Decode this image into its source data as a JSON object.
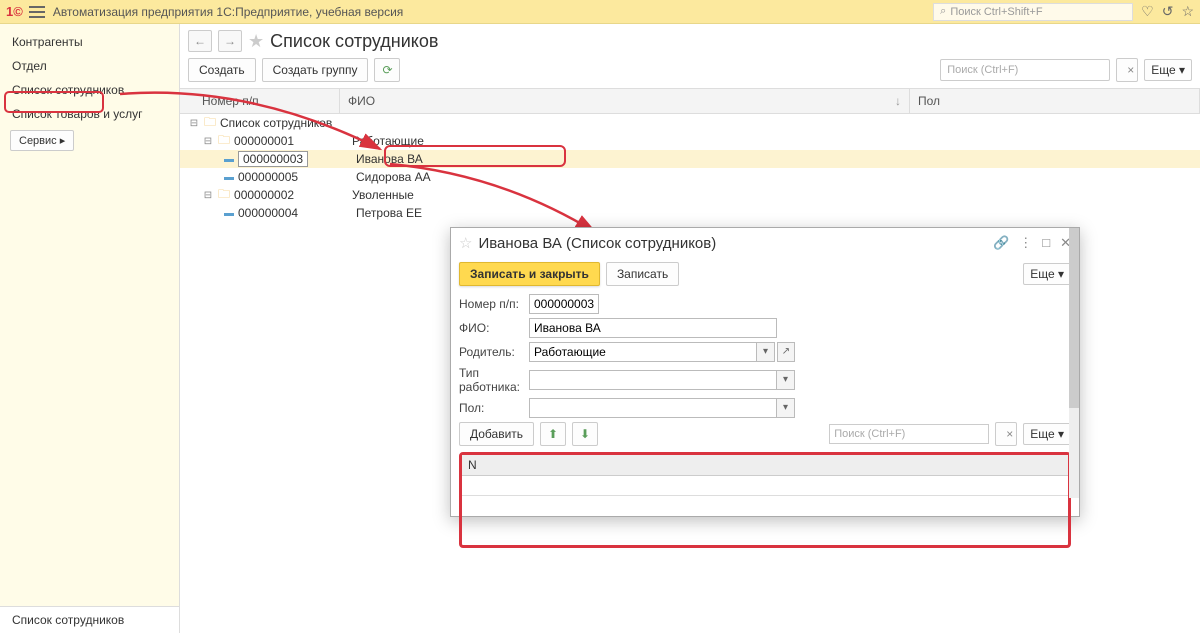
{
  "topbar": {
    "logo": "1©",
    "title": "Автоматизация предприятия 1С:Предприятие, учебная версия",
    "search_placeholder": "Поиск Ctrl+Shift+F"
  },
  "sidebar": {
    "items": [
      {
        "label": "Контрагенты"
      },
      {
        "label": "Отдел"
      },
      {
        "label": "Список сотрудников"
      },
      {
        "label": "Список товаров и услуг"
      }
    ],
    "service": "Сервис ▸",
    "bottom": "Список сотрудников"
  },
  "page": {
    "title": "Список сотрудников",
    "create": "Создать",
    "create_group": "Создать группу",
    "search_placeholder": "Поиск (Ctrl+F)",
    "more": "Еще ▾",
    "cols": {
      "num": "Номер п/п",
      "fio": "ФИО",
      "pol": "Пол"
    }
  },
  "tree": {
    "root": "Список сотрудников",
    "groups": [
      {
        "num": "000000001",
        "name": "Работающие",
        "children": [
          {
            "num": "000000003",
            "fio": "Иванова ВА",
            "selected": true
          },
          {
            "num": "000000005",
            "fio": "Сидорова АА"
          }
        ]
      },
      {
        "num": "000000002",
        "name": "Уволенные",
        "children": [
          {
            "num": "000000004",
            "fio": "Петрова ЕЕ"
          }
        ]
      }
    ]
  },
  "modal": {
    "title": "Иванова ВА (Список сотрудников)",
    "save_close": "Записать и закрыть",
    "save": "Записать",
    "more": "Еще ▾",
    "labels": {
      "num": "Номер п/п:",
      "fio": "ФИО:",
      "parent": "Родитель:",
      "type": "Тип работника:",
      "pol": "Пол:"
    },
    "values": {
      "num": "000000003",
      "fio": "Иванова ВА",
      "parent": "Работающие"
    },
    "add": "Добавить",
    "search_placeholder": "Поиск (Ctrl+F)",
    "grid_col": "N"
  }
}
